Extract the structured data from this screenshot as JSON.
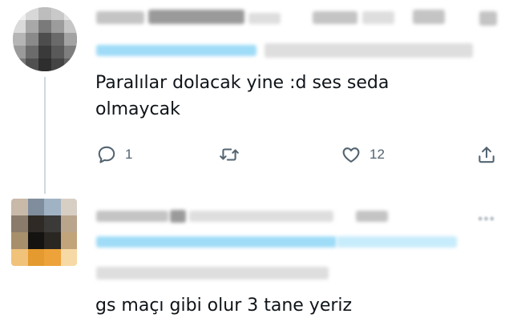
{
  "tweets": [
    {
      "text_lines": [
        "Paralılar dolacak yine :d ses seda",
        "olmaycak"
      ],
      "actions": {
        "reply": {
          "icon": "reply-icon",
          "count": "1"
        },
        "retweet": {
          "icon": "retweet-icon",
          "count": ""
        },
        "like": {
          "icon": "heart-icon",
          "count": "12"
        },
        "share": {
          "icon": "share-icon"
        }
      }
    },
    {
      "text_lines": [
        "gs maçı gibi olur 3 tane yeriz"
      ]
    }
  ],
  "colors": {
    "icon": "#536471",
    "thread_line": "#cfd9de",
    "text": "#0f1419"
  }
}
